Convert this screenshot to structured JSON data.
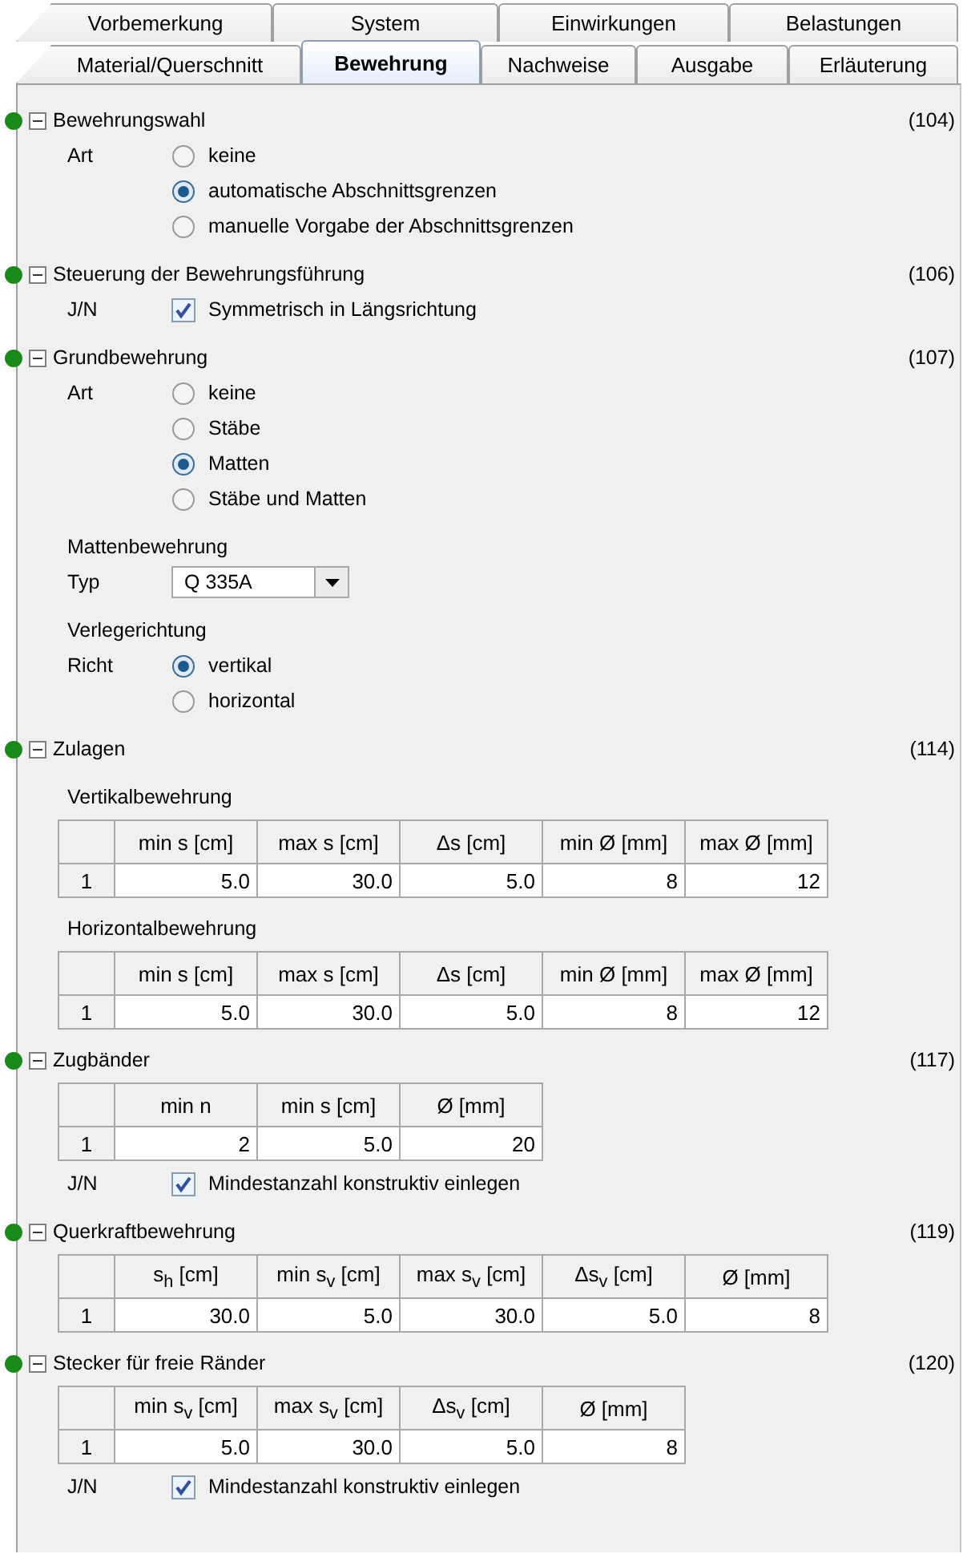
{
  "tabs_row_1": [
    {
      "label": "Vorbemerkung",
      "selected": false
    },
    {
      "label": "System",
      "selected": false
    },
    {
      "label": "Einwirkungen",
      "selected": false
    },
    {
      "label": "Belastungen",
      "selected": false
    }
  ],
  "tabs_row_2": [
    {
      "label": "Material/Querschnitt",
      "selected": false
    },
    {
      "label": "Bewehrung",
      "selected": true
    },
    {
      "label": "Nachweise",
      "selected": false
    },
    {
      "label": "Ausgabe",
      "selected": false
    },
    {
      "label": "Erläuterung",
      "selected": false
    }
  ],
  "sections": [
    {
      "title": "Bewehrungswahl",
      "number": "(104)",
      "expanded": true,
      "items": [
        {
          "kind": "radio",
          "label": "Art",
          "options": [
            {
              "label": "keine",
              "selected": false
            },
            {
              "label": "automatische Abschnittsgrenzen",
              "selected": true
            },
            {
              "label": "manuelle Vorgabe der Abschnittsgrenzen",
              "selected": false
            }
          ]
        }
      ]
    },
    {
      "title": "Steuerung der Bewehrungsführung",
      "number": "(106)",
      "expanded": true,
      "items": [
        {
          "kind": "checkbox",
          "label": "J/N",
          "text": "Symmetrisch in Längsrichtung",
          "checked": true
        }
      ]
    },
    {
      "title": "Grundbewehrung",
      "number": "(107)",
      "expanded": true,
      "items": [
        {
          "kind": "radio",
          "label": "Art",
          "options": [
            {
              "label": "keine",
              "selected": false
            },
            {
              "label": "Stäbe",
              "selected": false
            },
            {
              "label": "Matten",
              "selected": true
            },
            {
              "label": "Stäbe und Matten",
              "selected": false
            }
          ]
        },
        {
          "kind": "heading",
          "text": "Mattenbewehrung"
        },
        {
          "kind": "dropdown",
          "label": "Typ",
          "value": "Q 335A"
        },
        {
          "kind": "heading",
          "text": "Verlegerichtung"
        },
        {
          "kind": "radio",
          "label": "Richt",
          "options": [
            {
              "label": "vertikal",
              "selected": true
            },
            {
              "label": "horizontal",
              "selected": false
            }
          ]
        }
      ]
    },
    {
      "title": "Zulagen",
      "number": "(114)",
      "expanded": true,
      "items": [
        {
          "kind": "heading",
          "text": "Vertikalbewehrung"
        },
        {
          "kind": "table",
          "columns": [
            "",
            "min s [cm]",
            "max s [cm]",
            "Δs [cm]",
            "min Ø [mm]",
            "max Ø [mm]"
          ],
          "rows": [
            [
              "1",
              "5.0",
              "30.0",
              "5.0",
              "8",
              "12"
            ]
          ]
        },
        {
          "kind": "heading",
          "text": "Horizontalbewehrung"
        },
        {
          "kind": "table",
          "columns": [
            "",
            "min s [cm]",
            "max s [cm]",
            "Δs [cm]",
            "min Ø [mm]",
            "max Ø [mm]"
          ],
          "rows": [
            [
              "1",
              "5.0",
              "30.0",
              "5.0",
              "8",
              "12"
            ]
          ]
        }
      ]
    },
    {
      "title": "Zugbänder",
      "number": "(117)",
      "expanded": true,
      "items": [
        {
          "kind": "table",
          "columns": [
            "",
            "min n",
            "min s [cm]",
            "Ø [mm]"
          ],
          "rows": [
            [
              "1",
              "2",
              "5.0",
              "20"
            ]
          ]
        },
        {
          "kind": "checkbox",
          "label": "J/N",
          "text": "Mindestanzahl konstruktiv einlegen",
          "checked": true
        }
      ]
    },
    {
      "title": "Querkraftbewehrung",
      "number": "(119)",
      "expanded": true,
      "items": [
        {
          "kind": "table",
          "columns": [
            "",
            "s$_{h}$ [cm]",
            "min s$_{v}$ [cm]",
            "max s$_{v}$ [cm]",
            "Δs$_{v}$ [cm]",
            "Ø [mm]"
          ],
          "rows": [
            [
              "1",
              "30.0",
              "5.0",
              "30.0",
              "5.0",
              "8"
            ]
          ]
        }
      ]
    },
    {
      "title": "Stecker für freie Ränder",
      "number": "(120)",
      "expanded": true,
      "items": [
        {
          "kind": "table",
          "columns": [
            "",
            "min s$_{v}$ [cm]",
            "max s$_{v}$ [cm]",
            "Δs$_{v}$ [cm]",
            "Ø [mm]"
          ],
          "rows": [
            [
              "1",
              "5.0",
              "30.0",
              "5.0",
              "8"
            ]
          ]
        },
        {
          "kind": "checkbox",
          "label": "J/N",
          "text": "Mindestanzahl konstruktiv einlegen",
          "checked": true
        }
      ]
    }
  ]
}
